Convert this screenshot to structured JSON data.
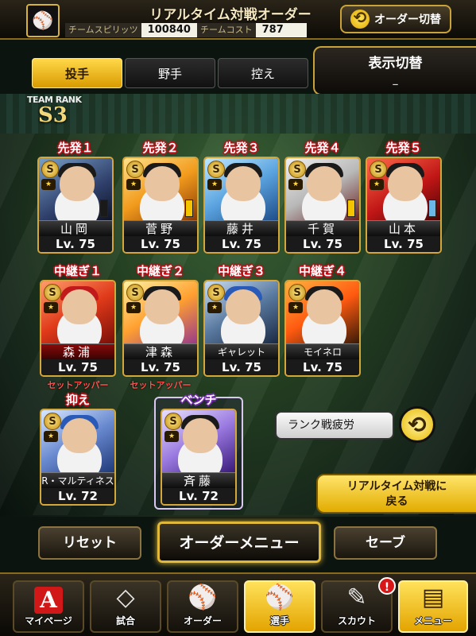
{
  "header": {
    "title": "リアルタイム対戦オーダー",
    "team_logo": "⚾",
    "spirit_label": "チームスピリッツ",
    "spirit_value": "100840",
    "cost_label": "チームコスト",
    "cost_value": "787",
    "order_switch_label": "オーダー切替"
  },
  "tabs": [
    {
      "label": "投手",
      "active": true
    },
    {
      "label": "野手",
      "active": false
    },
    {
      "label": "控え",
      "active": false
    }
  ],
  "display_toggle": {
    "label": "表示切替",
    "value": "–"
  },
  "team_rank": {
    "label": "TEAM RANK",
    "value": "S3"
  },
  "starters": [
    {
      "slot": "先発１",
      "name": "山岡",
      "level": "Lv. 75",
      "rank": "S"
    },
    {
      "slot": "先発２",
      "name": "菅野",
      "level": "Lv. 75",
      "rank": "S"
    },
    {
      "slot": "先発３",
      "name": "藤井",
      "level": "Lv. 75",
      "rank": "S"
    },
    {
      "slot": "先発４",
      "name": "千賀",
      "level": "Lv. 75",
      "rank": "S"
    },
    {
      "slot": "先発５",
      "name": "山本",
      "level": "Lv. 75",
      "rank": "S"
    }
  ],
  "relievers": [
    {
      "slot": "中継ぎ１",
      "name": "森浦",
      "level": "Lv. 75",
      "rank": "S",
      "note": "セットアッパー"
    },
    {
      "slot": "中継ぎ２",
      "name": "津森",
      "level": "Lv. 75",
      "rank": "S",
      "note": "セットアッパー"
    },
    {
      "slot": "中継ぎ３",
      "name": "ギャレット",
      "level": "Lv. 75",
      "rank": "S",
      "note": ""
    },
    {
      "slot": "中継ぎ４",
      "name": "モイネロ",
      "level": "Lv. 75",
      "rank": "S",
      "note": ""
    }
  ],
  "closer": {
    "slot": "抑え",
    "name": "R・マルティネス",
    "level": "Lv. 72",
    "rank": "S"
  },
  "bench": {
    "slot": "ベンチ",
    "name": "斉藤",
    "level": "Lv. 72",
    "rank": "S"
  },
  "star_mark": "★",
  "fatigue_button": "ランク戦疲労",
  "return_button": {
    "line1": "リアルタイム対戦に",
    "line2": "戻る"
  },
  "actions": {
    "reset": "リセット",
    "order_menu": "オーダーメニュー",
    "save": "セーブ"
  },
  "nav": [
    {
      "label": "マイページ",
      "icon": "A"
    },
    {
      "label": "試合",
      "icon": "◇"
    },
    {
      "label": "オーダー",
      "icon": "⚾"
    },
    {
      "label": "選手",
      "icon": "⚾"
    },
    {
      "label": "スカウト",
      "icon": "✎"
    },
    {
      "label": "メニュー",
      "icon": "▤"
    }
  ],
  "notification_badge": "!",
  "colors": {
    "accent": "#e0b83a",
    "slot_red": "#c0101a",
    "highlight": "#ffd84a"
  }
}
